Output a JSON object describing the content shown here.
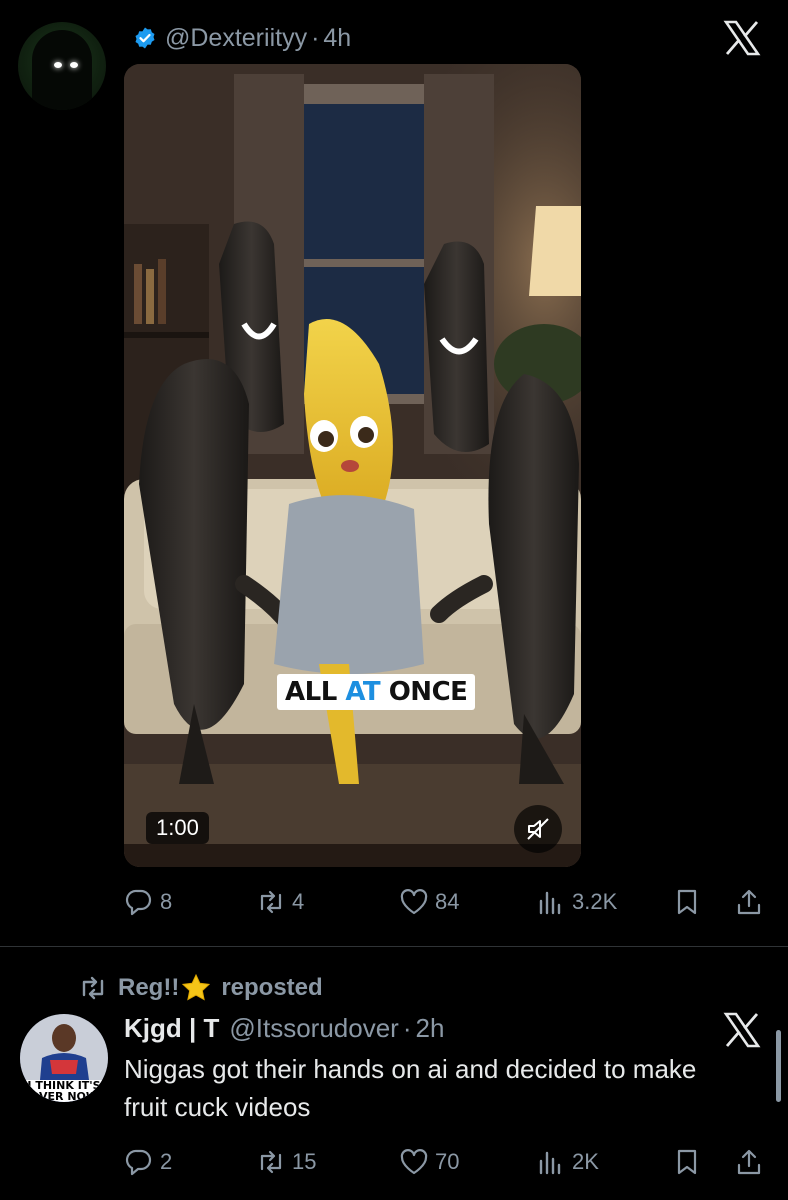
{
  "post1": {
    "handle": "@Dexteriityy",
    "sep": "·",
    "time": "4h",
    "media": {
      "caption_part1": "ALL ",
      "caption_part2": "AT",
      "caption_part3": " ONCE",
      "duration": "1:00"
    },
    "actions": {
      "replies": "8",
      "reposts": "4",
      "likes": "84",
      "views": "3.2K"
    }
  },
  "post2": {
    "reposted_by_name": "Reg!!",
    "reposted_label": "reposted",
    "author_name": "Kjgd | T",
    "author_handle": "@Itssorudover",
    "sep": "·",
    "time": "2h",
    "text": "Niggas got their hands on ai and decided to make fruit cuck videos",
    "avatar_text": "I THINK IT'S OVER NOW",
    "actions": {
      "replies": "2",
      "reposts": "15",
      "likes": "70",
      "views": "2K"
    }
  },
  "colors": {
    "background": "#000000",
    "text_primary": "#e7e9ea",
    "text_secondary": "#8b98a5",
    "verified_badge": "#1d9bf0",
    "caption_accent": "#1d8fe0"
  },
  "icons": [
    "verified-icon",
    "x-logo-icon",
    "mute-icon",
    "reply-icon",
    "repost-icon",
    "like-icon",
    "views-icon",
    "bookmark-icon",
    "share-icon",
    "star-icon"
  ]
}
